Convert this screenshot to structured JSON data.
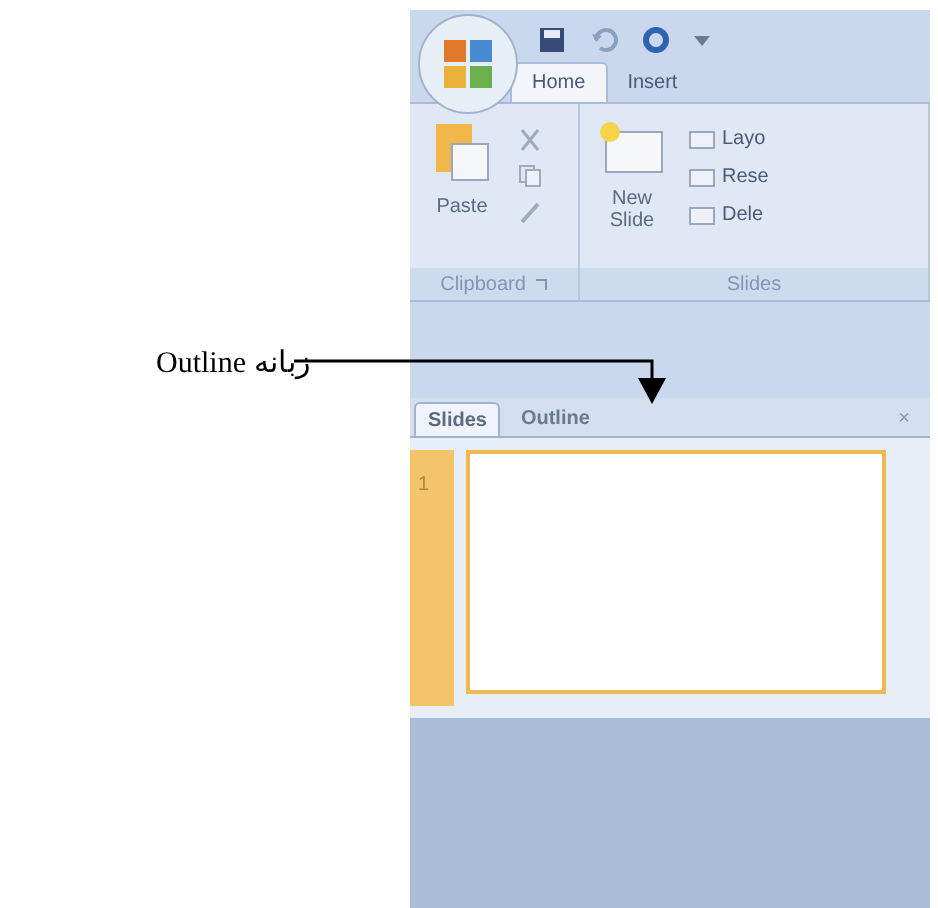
{
  "annotation": {
    "text": "زبانه Outline"
  },
  "ribbon_tabs": [
    {
      "label": "Home",
      "selected": true
    },
    {
      "label": "Insert",
      "selected": false
    }
  ],
  "groups": [
    {
      "label": "Clipboard",
      "big_button": "Paste"
    },
    {
      "label": "Slides",
      "big_button": "New Slide",
      "commands": [
        "Layo",
        "Rese",
        "Dele"
      ]
    }
  ],
  "pane_tabs": [
    {
      "label": "Slides",
      "selected": true
    },
    {
      "label": "Outline",
      "selected": false
    }
  ],
  "pane_close": "×",
  "slides": [
    {
      "number": "1",
      "selected": true
    }
  ]
}
